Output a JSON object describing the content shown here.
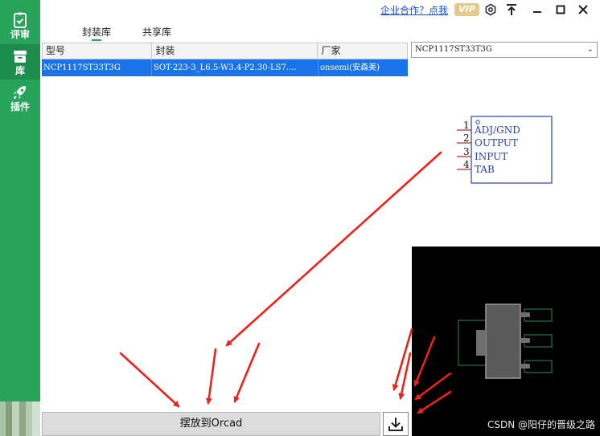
{
  "sidebar": {
    "items": [
      {
        "label": "评审",
        "icon": "clipboard-check-icon"
      },
      {
        "label": "库",
        "icon": "archive-box-icon"
      },
      {
        "label": "插件",
        "icon": "rocket-icon"
      }
    ]
  },
  "topbar": {
    "link": "企业合作？点我",
    "vip_badge": "VIP",
    "icons": [
      "settings-icon",
      "pin-top-icon",
      "minimize-icon",
      "maximize-icon",
      "close-icon"
    ]
  },
  "tabs": [
    {
      "label": "封装库",
      "active": true
    },
    {
      "label": "共享库",
      "active": false
    }
  ],
  "table": {
    "columns": [
      "型号",
      "封装",
      "厂家"
    ],
    "rows": [
      {
        "model": "NCP1117ST33T3G",
        "package": "SOT-223-3_L6.5-W3.4-P2.30-LS7....",
        "vendor": "onsemi(安森美)"
      }
    ]
  },
  "part_selector": {
    "selected": "NCP1117ST33T3G"
  },
  "symbol": {
    "pins": [
      {
        "num": "1",
        "name": "ADJ/GND"
      },
      {
        "num": "2",
        "name": "OUTPUT"
      },
      {
        "num": "3",
        "name": "INPUT"
      },
      {
        "num": "4",
        "name": "TAB"
      }
    ]
  },
  "footprint_preview": {
    "watermark": "CSDN @阳仔的晋级之路"
  },
  "actions": {
    "place_label": "摆放到Orcad",
    "download_icon": "download-icon"
  },
  "colors": {
    "sidebar": "#27a35a",
    "selection": "#1a73e8",
    "annotation_arrow": "#e8231c"
  }
}
